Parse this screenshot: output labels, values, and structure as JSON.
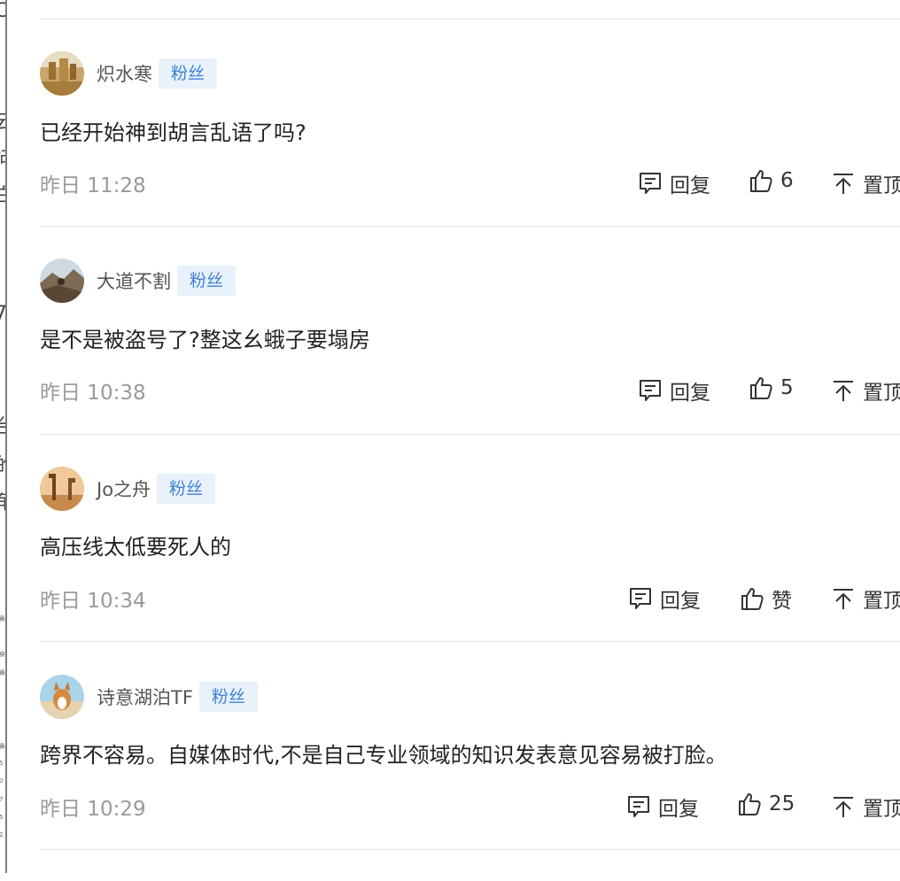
{
  "colors": {
    "badge_bg": "#e9f1fb",
    "badge_text": "#3e82d6",
    "time_text": "#9a9a9a",
    "divider": "#e4e4e4"
  },
  "comments": [
    {
      "username": "炽水寒",
      "badge": "粉丝",
      "text": "已经开始神到胡言乱语了吗?",
      "time": "昨日 11:28",
      "reply_label": "回复",
      "like_count": "6",
      "pin_label": "置顶",
      "avatar_icon": "avatar-golden-landscape-icon"
    },
    {
      "username": "大道不割",
      "badge": "粉丝",
      "text": "是不是被盗号了?整这幺蛾子要塌房",
      "time": "昨日 10:38",
      "reply_label": "回复",
      "like_count": "5",
      "pin_label": "置顶",
      "avatar_icon": "avatar-mountain-rider-icon"
    },
    {
      "username": "Jo之舟",
      "badge": "粉丝",
      "text": "高压线太低要死人的",
      "time": "昨日 10:34",
      "reply_label": "回复",
      "like_count": "赞",
      "pin_label": "置顶",
      "avatar_icon": "avatar-giraffes-icon"
    },
    {
      "username": "诗意湖泊TF",
      "badge": "粉丝",
      "text": "跨界不容易。自媒体时代,不是自己专业领域的知识发表意见容易被打脸。",
      "time": "昨日 10:29",
      "reply_label": "回复",
      "like_count": "25",
      "pin_label": "置顶",
      "avatar_icon": "avatar-corgi-icon"
    }
  ]
}
